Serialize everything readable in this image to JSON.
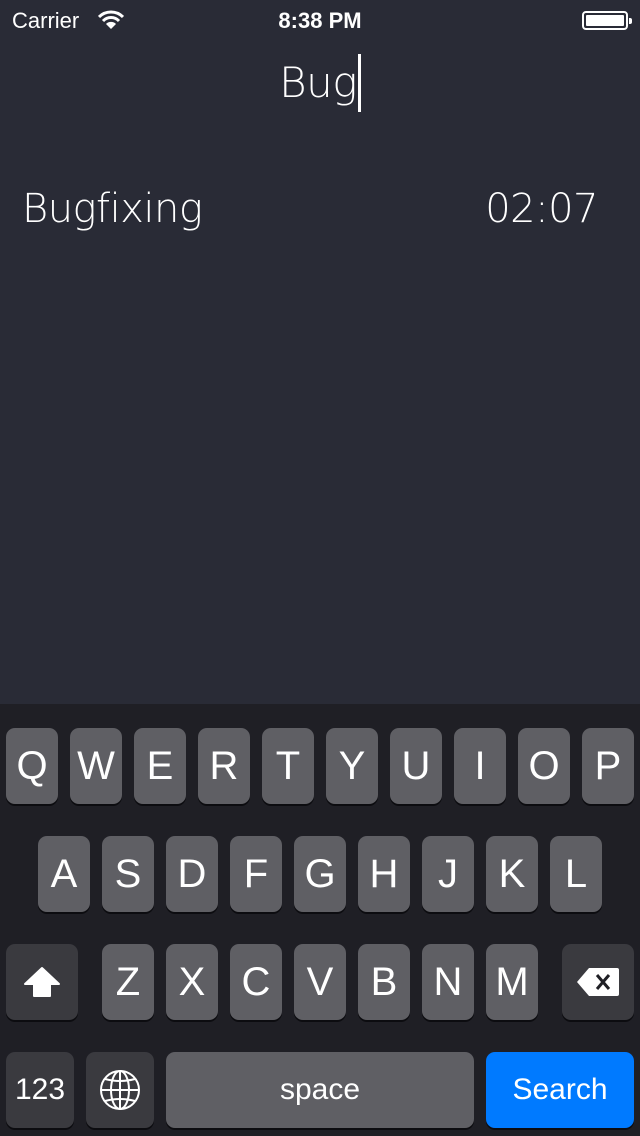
{
  "status_bar": {
    "carrier": "Carrier",
    "time": "8:38 PM",
    "wifi_icon": "wifi-icon",
    "battery_icon": "battery-icon"
  },
  "search": {
    "value": "Bug"
  },
  "results": [
    {
      "name": "Bugfixing",
      "duration": "02:07"
    }
  ],
  "keyboard": {
    "row1": [
      "Q",
      "W",
      "E",
      "R",
      "T",
      "Y",
      "U",
      "I",
      "O",
      "P"
    ],
    "row2": [
      "A",
      "S",
      "D",
      "F",
      "G",
      "H",
      "J",
      "K",
      "L"
    ],
    "row3": [
      "Z",
      "X",
      "C",
      "V",
      "B",
      "N",
      "M"
    ],
    "numbers_label": "123",
    "space_label": "space",
    "search_label": "Search",
    "shift_icon": "shift-icon",
    "globe_icon": "globe-icon",
    "backspace_icon": "backspace-icon"
  },
  "colors": {
    "background": "#292b36",
    "keyboard": "#1f1f25",
    "key": "#5f5f64",
    "key_special": "#3a3a3f",
    "accent": "#007aff"
  }
}
